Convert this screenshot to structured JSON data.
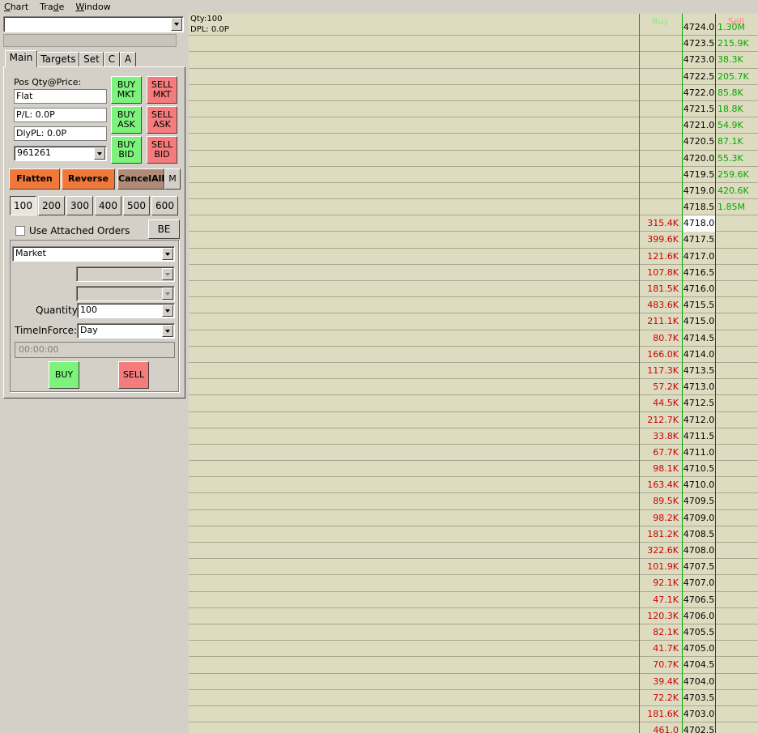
{
  "menu": [
    {
      "label": "Chart",
      "key": "C"
    },
    {
      "label": "Trade",
      "key": "d"
    },
    {
      "label": "Window",
      "key": "W"
    }
  ],
  "left": {
    "account_combo_value": "",
    "tabs": [
      "Main",
      "Targets",
      "Set",
      "C",
      "A"
    ],
    "active_tab": "Main",
    "pos_label": "Pos Qty@Price:",
    "pos_value": "Flat",
    "pl_value": "P/L: 0.0P",
    "dlypl_value": "DlyPL: 0.0P",
    "account_number": "961261",
    "buy_mkt": [
      "BUY",
      "MKT"
    ],
    "sell_mkt": [
      "SELL",
      "MKT"
    ],
    "buy_ask": [
      "BUY",
      "ASK"
    ],
    "sell_ask": [
      "SELL",
      "ASK"
    ],
    "buy_bid": [
      "BUY",
      "BID"
    ],
    "sell_bid": [
      "SELL",
      "BID"
    ],
    "flatten": "Flatten",
    "reverse": "Reverse",
    "cancel_all": "CancelAll",
    "m_button": "M",
    "quantities": [
      "100",
      "200",
      "300",
      "400",
      "500",
      "600"
    ],
    "selected_quantity": "100",
    "use_attached_orders": "Use Attached Orders",
    "be_button": "BE",
    "order_type": "Market",
    "quantity_label": "Quantity:",
    "quantity_value": "100",
    "tif_label": "TimeInForce:",
    "tif_value": "Day",
    "time_value": "00:00:00",
    "buy_button": "BUY",
    "sell_button": "SELL"
  },
  "ladder": {
    "qty_label": "Qty:100",
    "dpl_label": "DPL: 0.0P",
    "buy_header": "Buy",
    "sell_header": "Sell",
    "current_price": "4718.0",
    "rows": [
      {
        "price": "4724.0",
        "buy": "",
        "sell": "1.30M"
      },
      {
        "price": "4723.5",
        "buy": "",
        "sell": "215.9K"
      },
      {
        "price": "4723.0",
        "buy": "",
        "sell": "38.3K"
      },
      {
        "price": "4722.5",
        "buy": "",
        "sell": "205.7K"
      },
      {
        "price": "4722.0",
        "buy": "",
        "sell": "85.8K"
      },
      {
        "price": "4721.5",
        "buy": "",
        "sell": "18.8K"
      },
      {
        "price": "4721.0",
        "buy": "",
        "sell": "54.9K"
      },
      {
        "price": "4720.5",
        "buy": "",
        "sell": "87.1K"
      },
      {
        "price": "4720.0",
        "buy": "",
        "sell": "55.3K"
      },
      {
        "price": "4719.5",
        "buy": "",
        "sell": "259.6K"
      },
      {
        "price": "4719.0",
        "buy": "",
        "sell": "420.6K"
      },
      {
        "price": "4718.5",
        "buy": "",
        "sell": "1.85M"
      },
      {
        "price": "4718.0",
        "buy": "315.4K",
        "sell": ""
      },
      {
        "price": "4717.5",
        "buy": "399.6K",
        "sell": ""
      },
      {
        "price": "4717.0",
        "buy": "121.6K",
        "sell": ""
      },
      {
        "price": "4716.5",
        "buy": "107.8K",
        "sell": ""
      },
      {
        "price": "4716.0",
        "buy": "181.5K",
        "sell": ""
      },
      {
        "price": "4715.5",
        "buy": "483.6K",
        "sell": ""
      },
      {
        "price": "4715.0",
        "buy": "211.1K",
        "sell": ""
      },
      {
        "price": "4714.5",
        "buy": "80.7K",
        "sell": ""
      },
      {
        "price": "4714.0",
        "buy": "166.0K",
        "sell": ""
      },
      {
        "price": "4713.5",
        "buy": "117.3K",
        "sell": ""
      },
      {
        "price": "4713.0",
        "buy": "57.2K",
        "sell": ""
      },
      {
        "price": "4712.5",
        "buy": "44.5K",
        "sell": ""
      },
      {
        "price": "4712.0",
        "buy": "212.7K",
        "sell": ""
      },
      {
        "price": "4711.5",
        "buy": "33.8K",
        "sell": ""
      },
      {
        "price": "4711.0",
        "buy": "67.7K",
        "sell": ""
      },
      {
        "price": "4710.5",
        "buy": "98.1K",
        "sell": ""
      },
      {
        "price": "4710.0",
        "buy": "163.4K",
        "sell": ""
      },
      {
        "price": "4709.5",
        "buy": "89.5K",
        "sell": ""
      },
      {
        "price": "4709.0",
        "buy": "98.2K",
        "sell": ""
      },
      {
        "price": "4708.5",
        "buy": "181.2K",
        "sell": ""
      },
      {
        "price": "4708.0",
        "buy": "322.6K",
        "sell": ""
      },
      {
        "price": "4707.5",
        "buy": "101.9K",
        "sell": ""
      },
      {
        "price": "4707.0",
        "buy": "92.1K",
        "sell": ""
      },
      {
        "price": "4706.5",
        "buy": "47.1K",
        "sell": ""
      },
      {
        "price": "4706.0",
        "buy": "120.3K",
        "sell": ""
      },
      {
        "price": "4705.5",
        "buy": "82.1K",
        "sell": ""
      },
      {
        "price": "4705.0",
        "buy": "41.7K",
        "sell": ""
      },
      {
        "price": "4704.5",
        "buy": "70.7K",
        "sell": ""
      },
      {
        "price": "4704.0",
        "buy": "39.4K",
        "sell": ""
      },
      {
        "price": "4703.5",
        "buy": "72.2K",
        "sell": ""
      },
      {
        "price": "4703.0",
        "buy": "181.6K",
        "sell": ""
      },
      {
        "price": "4702.5",
        "buy": "461.0",
        "sell": ""
      }
    ]
  },
  "colors": {
    "buy_green": "#7cf47c",
    "sell_red": "#f47c7c",
    "orange": "#f07838",
    "ladder_bg": "#dedcc0",
    "bid_text": "#cc0000",
    "ask_text": "#00aa00"
  }
}
